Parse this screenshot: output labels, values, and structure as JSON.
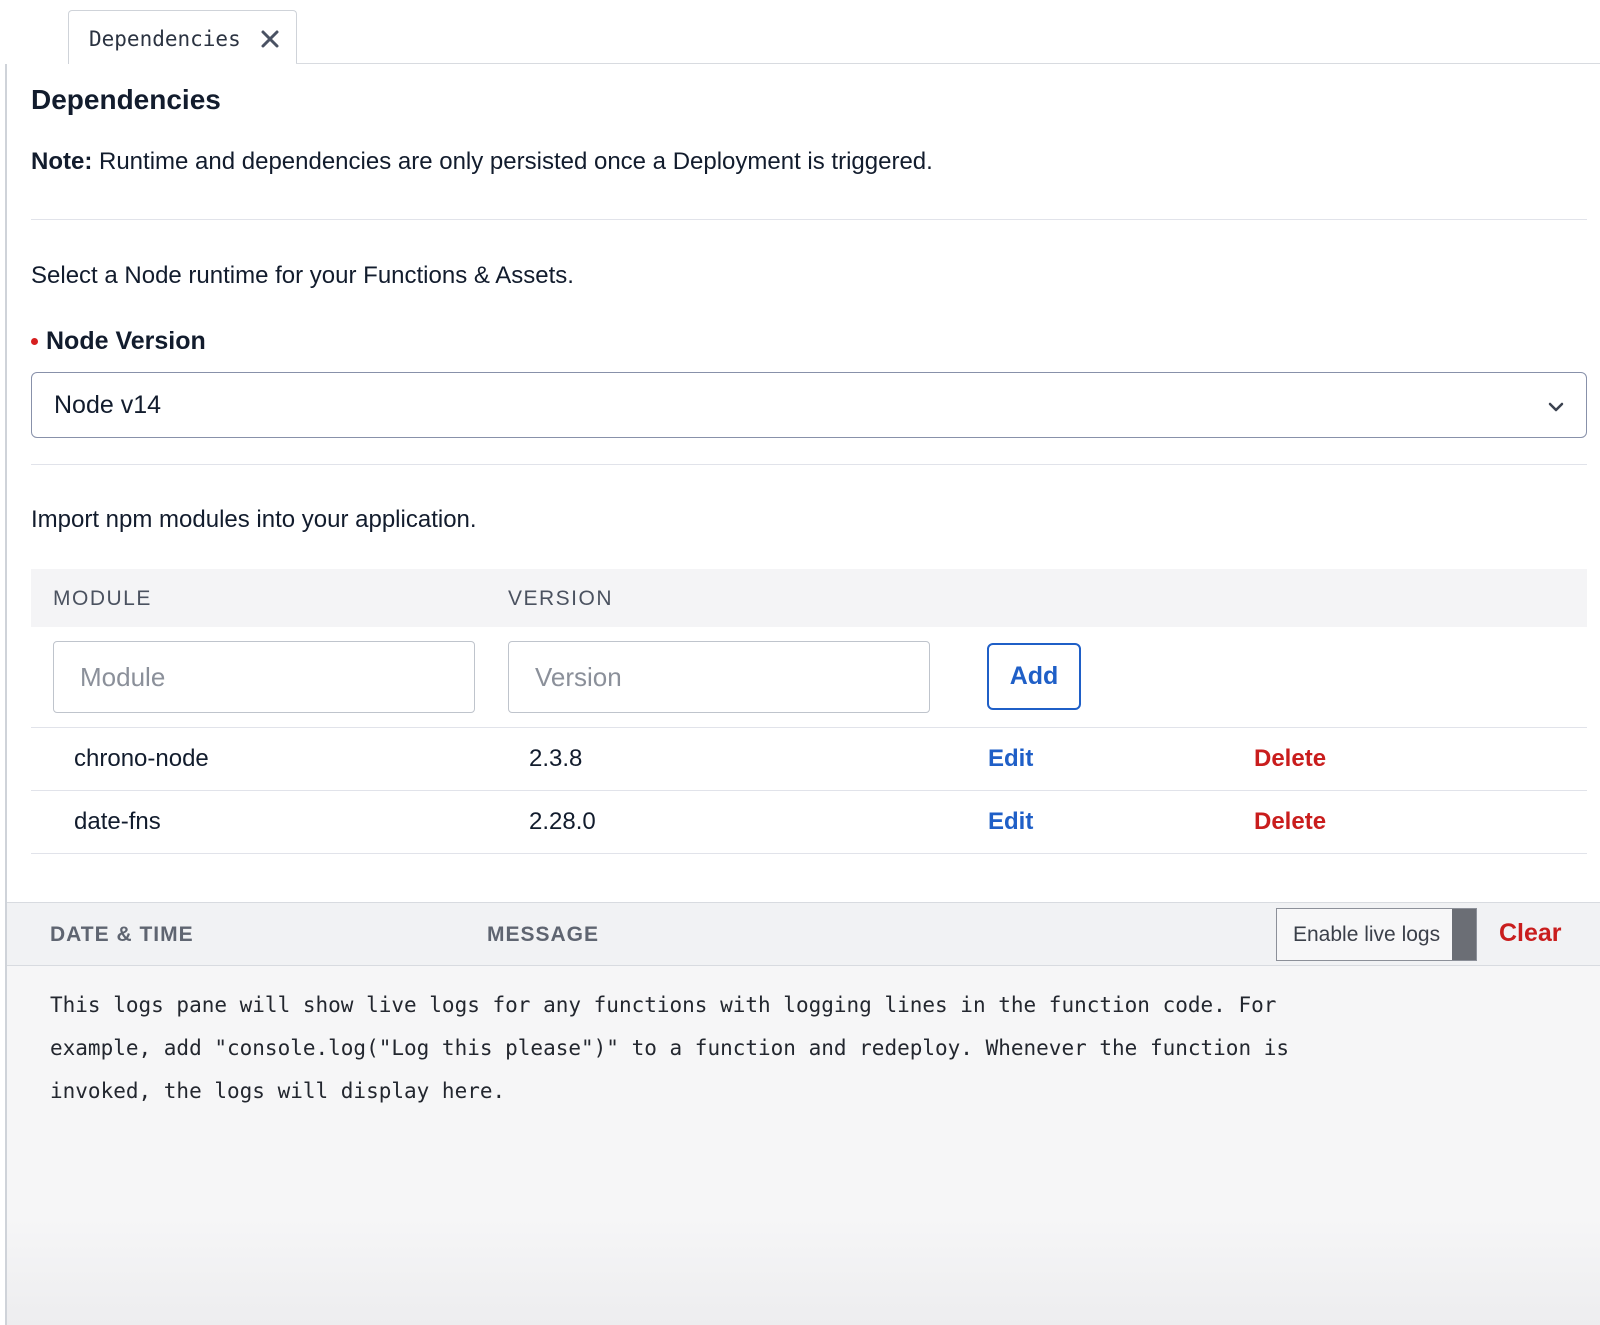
{
  "tab": {
    "label": "Dependencies"
  },
  "panel": {
    "title": "Dependencies",
    "note_label": "Note:",
    "note_text": " Runtime and dependencies are only persisted once a Deployment is triggered.",
    "runtime_hint": "Select a Node runtime for your Functions & Assets.",
    "node_version_label": "Node Version",
    "node_version_value": "Node v14",
    "modules_hint": "Import npm modules into your application."
  },
  "table": {
    "headers": [
      "MODULE",
      "VERSION"
    ],
    "module_placeholder": "Module",
    "version_placeholder": "Version",
    "add_label": "Add",
    "rows": [
      {
        "module": "chrono-node",
        "version": "2.3.8",
        "edit": "Edit",
        "delete": "Delete"
      },
      {
        "module": "date-fns",
        "version": "2.28.0",
        "edit": "Edit",
        "delete": "Delete"
      }
    ]
  },
  "logs": {
    "headers": [
      "DATE & TIME",
      "MESSAGE"
    ],
    "live_toggle_label": "Enable live logs",
    "clear_label": "Clear",
    "message": "This logs pane will show live logs for any functions with logging lines in the function code. For example, add \"console.log(\"Log this please\")\" to a function and redeploy. Whenever the function is invoked, the logs will display here."
  },
  "colors": {
    "link": "#1f5fc7",
    "danger": "#c91d1d",
    "required": "#d61f1f"
  },
  "icons": {
    "tab_close": "close-icon",
    "select_chevron": "chevron-down-icon"
  }
}
